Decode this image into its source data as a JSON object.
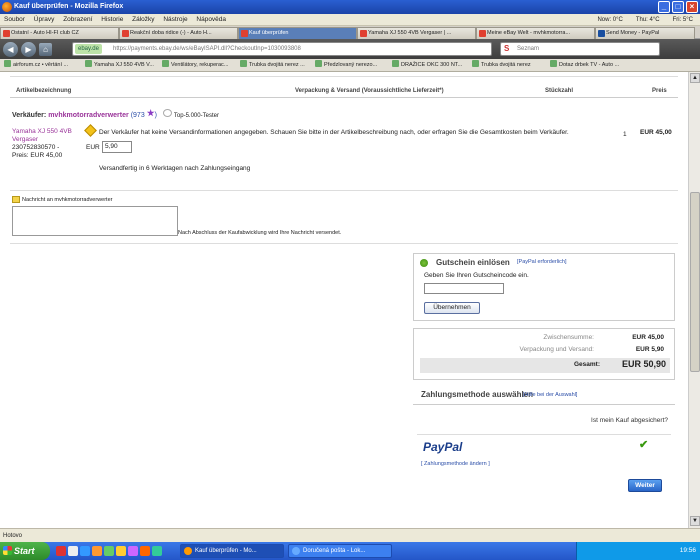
{
  "window": {
    "title": "Kauf überprüfen - Mozilla Firefox"
  },
  "menu": [
    "Soubor",
    "Úpravy",
    "Zobrazení",
    "Historie",
    "Záložky",
    "Nástroje",
    "Nápověda"
  ],
  "weather": [
    "Now: 0°C",
    "Thu: 4°C",
    "Fri: 5°C"
  ],
  "tabs": [
    "Ostatní - Auto HI-FI club CZ",
    "Reakční doba ridice (-) - Auto H...",
    "Kauf überprüfen",
    "Yamaha XJ 550 4VB Vergaser | ...",
    "Meine eBay Welt - mvhkmotorra...",
    "Send Money - PayPal"
  ],
  "address": {
    "domain": "ebay.de",
    "url": "https://payments.ebay.de/ws/eBayISAPI.dll?CheckoutInp=1030093808"
  },
  "search": {
    "placeholder": "Seznam"
  },
  "bookmarks": [
    "airforum.cz • věrtání ...",
    "Yamaha XJ 550 4VB V...",
    "Ventilátory, rekuperac...",
    "Trubka dvojitá nerez ...",
    "Předzlovaný nerezo...",
    "DRAŽICE OKC 300 NT...",
    "Trubka dvojitá nerez",
    "Dotaz drbek TV - Auto ..."
  ],
  "columns": {
    "item": "Artikelbezeichnung",
    "shipping": "Verpackung & Versand (Voraussichtliche Lieferzeit*)",
    "qty": "Stückzahl",
    "price": "Preis"
  },
  "seller": {
    "label": "Verkäufer:",
    "name": "mvhkmotorradverwerter",
    "score": "973",
    "badge": "Top-5.000-Tester"
  },
  "item": {
    "title": "Yamaha XJ 550 4VB Vergaser",
    "number": "230752830570 -",
    "price_label": "Preis: EUR 45,00",
    "qty": "1",
    "price": "EUR 45,00"
  },
  "shipping": {
    "warning": "Der Verkäufer hat keine Versandinformationen angegeben. Schauen Sie bitte in der Artikelbeschreibung nach, oder erfragen Sie die Gesamtkosten beim Verkäufer.",
    "currency": "EUR",
    "value": "5,90",
    "ready": "Versandfertig in 6 Werktagen nach Zahlungseingang"
  },
  "message": {
    "label": "Nachricht an mvhkmotorradverwerter",
    "note": "Nach Abschluss der Kaufabwicklung wird Ihre Nachricht versendet."
  },
  "coupon": {
    "title": "Gutschein einlösen",
    "link": "[PayPal erforderlich]",
    "prompt": "Geben Sie Ihren Gutscheincode ein.",
    "button": "Übernehmen"
  },
  "totals": {
    "subtotal_label": "Zwischensumme:",
    "subtotal": "EUR 45,00",
    "shipping_label": "Verpackung und Versand:",
    "shipping": "EUR 5,90",
    "total_label": "Gesamt:",
    "total": "EUR 50,90"
  },
  "payment": {
    "title": "Zahlungsmethode auswählen",
    "help": "[Hilfe bei der Auswahl]",
    "protect": "Ist mein Kauf abgesichert?",
    "provider": "PayPal",
    "change": "[ Zahlungsmethode ändern ]",
    "next": "Weiter"
  },
  "status": "Hotovo",
  "taskbar": {
    "start": "Start",
    "items": [
      "Kauf überprüfen - Mo...",
      "Doručená pošta - Lok..."
    ],
    "time": "19:56"
  }
}
